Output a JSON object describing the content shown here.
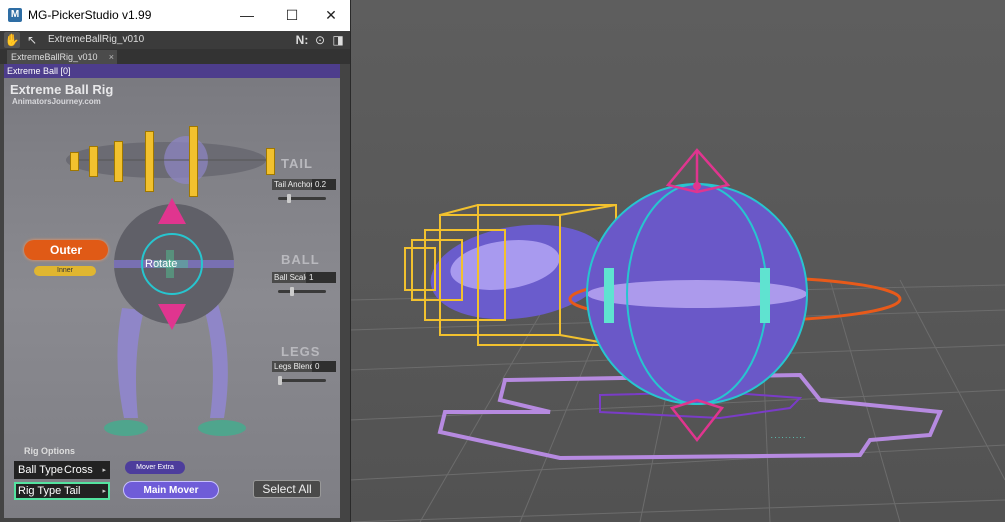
{
  "window": {
    "title": "MG-PickerStudio v1.99",
    "icon_letter": "M",
    "controls": {
      "minimize": "—",
      "maximize": "☐",
      "close": "✕"
    }
  },
  "toolbar": {
    "picker_name": "ExtremeBallRig_v010",
    "right_icons": [
      "N:",
      "⊙",
      "◨"
    ]
  },
  "tab": {
    "label": "ExtremeBallRig_v010",
    "close": "×"
  },
  "picker_header": "Extreme Ball [0]",
  "picker": {
    "title": "Extreme Ball Rig",
    "site": "AnimatorsJourney.com",
    "tail": {
      "label": "TAIL",
      "field": "Tail Anchor",
      "value": "0.2"
    },
    "ball": {
      "label": "BALL",
      "field": "Ball Scale",
      "value": "1"
    },
    "legs": {
      "label": "LEGS",
      "field": "Legs Blend",
      "value": "0"
    },
    "outer": "Outer",
    "inner": "Inner",
    "rotate": "Rotate",
    "rig_options": "Rig Options",
    "ball_type_label": "Ball Type",
    "ball_type_value": "Cross",
    "rig_type_label": "Rig Type",
    "rig_type_value": "Tail",
    "mover_extra": "Mover Extra",
    "main_mover": "Main Mover",
    "select_all": "Select All"
  },
  "colors": {
    "accent_purple": "#6f5cd8",
    "outer_orange": "#e05a16",
    "control_yellow": "#f2c12e",
    "arrow_pink": "#e0358f",
    "ring_cyan": "#27c5cf"
  }
}
